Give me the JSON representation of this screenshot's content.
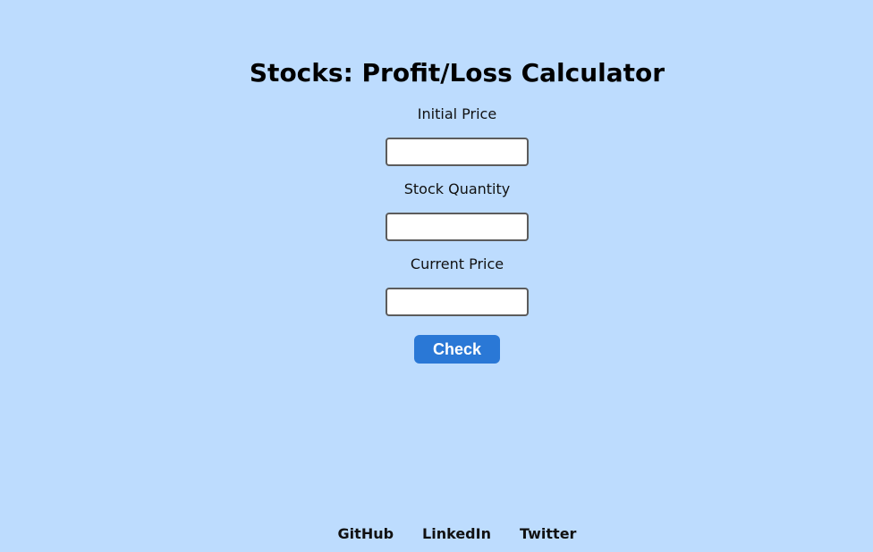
{
  "app": {
    "title": "Stocks: Profit/Loss Calculator"
  },
  "form": {
    "fields": [
      {
        "label": "Initial Price",
        "value": "",
        "placeholder": ""
      },
      {
        "label": "Stock Quantity",
        "value": "",
        "placeholder": ""
      },
      {
        "label": "Current Price",
        "value": "",
        "placeholder": ""
      }
    ],
    "check_label": "Check"
  },
  "footer": {
    "links": [
      {
        "label": "GitHub",
        "icon": "github"
      },
      {
        "label": "LinkedIn",
        "icon": "linkedin"
      },
      {
        "label": "Twitter",
        "icon": "twitter"
      }
    ]
  },
  "colors": {
    "background": "#bddcfe",
    "accent": "#2a78d6",
    "text": "#111111"
  }
}
